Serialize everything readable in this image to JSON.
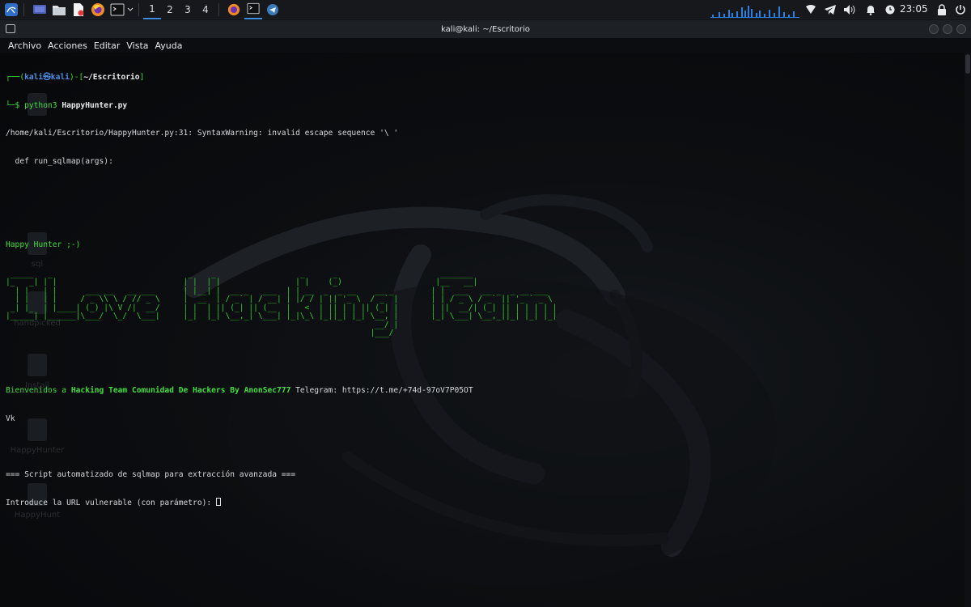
{
  "panel": {
    "workspaces": [
      "1",
      "2",
      "3",
      "4"
    ],
    "active_workspace": "1",
    "clock": "23:05",
    "accent": "#3d8ee0"
  },
  "window": {
    "title": "kali@kali: ~/Escritorio",
    "menu": [
      "Archivo",
      "Acciones",
      "Editar",
      "Vista",
      "Ayuda"
    ]
  },
  "desktop_icons": [
    "sql",
    "handpicked",
    "Install",
    "HappyHunter",
    "HappyHunt"
  ],
  "terminal": {
    "prompt_open": "┌──(",
    "prompt_user": "kali㉿kali",
    "prompt_mid": ")-[",
    "prompt_path": "~/Escritorio",
    "prompt_close": "]",
    "prompt_dollar": "└─$ ",
    "command_bin": "python3 ",
    "command_arg": "HappyHunter.py",
    "warning": "/home/kali/Escritorio/HappyHunter.py:31: SyntaxWarning: invalid escape sequence '\\ '",
    "warning_code": "  def run_sqlmap(args):",
    "happy": "Happy Hunter ;-)",
    "banner": " _____   _                             _    _                  _      _                      _______                          \n|_   _| | |                           | |  | |                | |    (_)                    |__   __|                         \n  | |   | |      ___ __   __ ___      | |__| |  __ _   ___  | | __  _  _ __    __ _        | |  ___   __ _  _ __ ___        \n  | |   | |     / _ \\\\ \\ / // _ \\     |  __  | / _` | / __| | |/ / | || '_ \\  / _` |       | | / _ \\ / _` || '_ ` _ \\       \n _| |_  | |____| (_) |\\ V /|  __/     | |  | || (_| || (__  |   <  | || | | || (_| |       | ||  __/| (_| || | | | | |      \n|_____| |______|\\___/  \\_/  \\___|     |_|  |_| \\__,_| \\___| |_|\\_\\ |_||_| |_| \\__, |       |_| \\___| \\__,_||_| |_| |_|      \n                                                                               __/ |                                           \n                                                                              |___/                                            ",
    "welcome_pre": "Bienvenidos a ",
    "welcome_bold": "Hacking Team Comunidad De Hackers By AnonSec777",
    "welcome_post": " Telegram: https://t.me/+74d-97oV7P05OT",
    "welcome_wrap": "Vk",
    "section": "=== Script automatizado de sqlmap para extracción avanzada ===",
    "input_prompt": "Introduce la URL vulnerable (con parámetro): "
  }
}
